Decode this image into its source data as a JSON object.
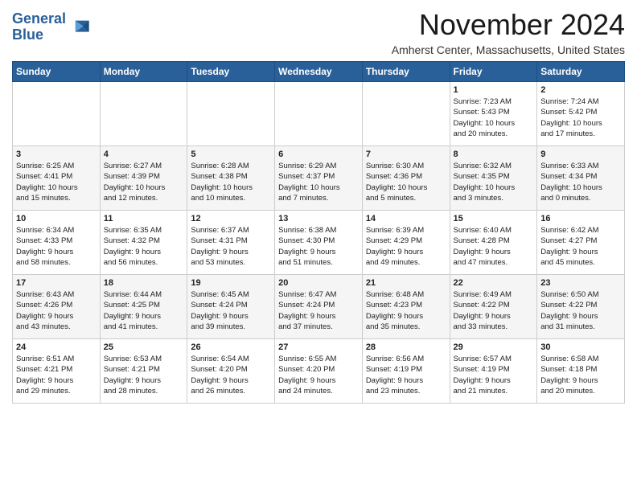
{
  "logo": {
    "line1": "General",
    "line2": "Blue"
  },
  "header": {
    "month_year": "November 2024",
    "location": "Amherst Center, Massachusetts, United States"
  },
  "weekdays": [
    "Sunday",
    "Monday",
    "Tuesday",
    "Wednesday",
    "Thursday",
    "Friday",
    "Saturday"
  ],
  "weeks": [
    [
      {
        "day": "",
        "info": ""
      },
      {
        "day": "",
        "info": ""
      },
      {
        "day": "",
        "info": ""
      },
      {
        "day": "",
        "info": ""
      },
      {
        "day": "",
        "info": ""
      },
      {
        "day": "1",
        "info": "Sunrise: 7:23 AM\nSunset: 5:43 PM\nDaylight: 10 hours\nand 20 minutes."
      },
      {
        "day": "2",
        "info": "Sunrise: 7:24 AM\nSunset: 5:42 PM\nDaylight: 10 hours\nand 17 minutes."
      }
    ],
    [
      {
        "day": "3",
        "info": "Sunrise: 6:25 AM\nSunset: 4:41 PM\nDaylight: 10 hours\nand 15 minutes."
      },
      {
        "day": "4",
        "info": "Sunrise: 6:27 AM\nSunset: 4:39 PM\nDaylight: 10 hours\nand 12 minutes."
      },
      {
        "day": "5",
        "info": "Sunrise: 6:28 AM\nSunset: 4:38 PM\nDaylight: 10 hours\nand 10 minutes."
      },
      {
        "day": "6",
        "info": "Sunrise: 6:29 AM\nSunset: 4:37 PM\nDaylight: 10 hours\nand 7 minutes."
      },
      {
        "day": "7",
        "info": "Sunrise: 6:30 AM\nSunset: 4:36 PM\nDaylight: 10 hours\nand 5 minutes."
      },
      {
        "day": "8",
        "info": "Sunrise: 6:32 AM\nSunset: 4:35 PM\nDaylight: 10 hours\nand 3 minutes."
      },
      {
        "day": "9",
        "info": "Sunrise: 6:33 AM\nSunset: 4:34 PM\nDaylight: 10 hours\nand 0 minutes."
      }
    ],
    [
      {
        "day": "10",
        "info": "Sunrise: 6:34 AM\nSunset: 4:33 PM\nDaylight: 9 hours\nand 58 minutes."
      },
      {
        "day": "11",
        "info": "Sunrise: 6:35 AM\nSunset: 4:32 PM\nDaylight: 9 hours\nand 56 minutes."
      },
      {
        "day": "12",
        "info": "Sunrise: 6:37 AM\nSunset: 4:31 PM\nDaylight: 9 hours\nand 53 minutes."
      },
      {
        "day": "13",
        "info": "Sunrise: 6:38 AM\nSunset: 4:30 PM\nDaylight: 9 hours\nand 51 minutes."
      },
      {
        "day": "14",
        "info": "Sunrise: 6:39 AM\nSunset: 4:29 PM\nDaylight: 9 hours\nand 49 minutes."
      },
      {
        "day": "15",
        "info": "Sunrise: 6:40 AM\nSunset: 4:28 PM\nDaylight: 9 hours\nand 47 minutes."
      },
      {
        "day": "16",
        "info": "Sunrise: 6:42 AM\nSunset: 4:27 PM\nDaylight: 9 hours\nand 45 minutes."
      }
    ],
    [
      {
        "day": "17",
        "info": "Sunrise: 6:43 AM\nSunset: 4:26 PM\nDaylight: 9 hours\nand 43 minutes."
      },
      {
        "day": "18",
        "info": "Sunrise: 6:44 AM\nSunset: 4:25 PM\nDaylight: 9 hours\nand 41 minutes."
      },
      {
        "day": "19",
        "info": "Sunrise: 6:45 AM\nSunset: 4:24 PM\nDaylight: 9 hours\nand 39 minutes."
      },
      {
        "day": "20",
        "info": "Sunrise: 6:47 AM\nSunset: 4:24 PM\nDaylight: 9 hours\nand 37 minutes."
      },
      {
        "day": "21",
        "info": "Sunrise: 6:48 AM\nSunset: 4:23 PM\nDaylight: 9 hours\nand 35 minutes."
      },
      {
        "day": "22",
        "info": "Sunrise: 6:49 AM\nSunset: 4:22 PM\nDaylight: 9 hours\nand 33 minutes."
      },
      {
        "day": "23",
        "info": "Sunrise: 6:50 AM\nSunset: 4:22 PM\nDaylight: 9 hours\nand 31 minutes."
      }
    ],
    [
      {
        "day": "24",
        "info": "Sunrise: 6:51 AM\nSunset: 4:21 PM\nDaylight: 9 hours\nand 29 minutes."
      },
      {
        "day": "25",
        "info": "Sunrise: 6:53 AM\nSunset: 4:21 PM\nDaylight: 9 hours\nand 28 minutes."
      },
      {
        "day": "26",
        "info": "Sunrise: 6:54 AM\nSunset: 4:20 PM\nDaylight: 9 hours\nand 26 minutes."
      },
      {
        "day": "27",
        "info": "Sunrise: 6:55 AM\nSunset: 4:20 PM\nDaylight: 9 hours\nand 24 minutes."
      },
      {
        "day": "28",
        "info": "Sunrise: 6:56 AM\nSunset: 4:19 PM\nDaylight: 9 hours\nand 23 minutes."
      },
      {
        "day": "29",
        "info": "Sunrise: 6:57 AM\nSunset: 4:19 PM\nDaylight: 9 hours\nand 21 minutes."
      },
      {
        "day": "30",
        "info": "Sunrise: 6:58 AM\nSunset: 4:18 PM\nDaylight: 9 hours\nand 20 minutes."
      }
    ]
  ]
}
